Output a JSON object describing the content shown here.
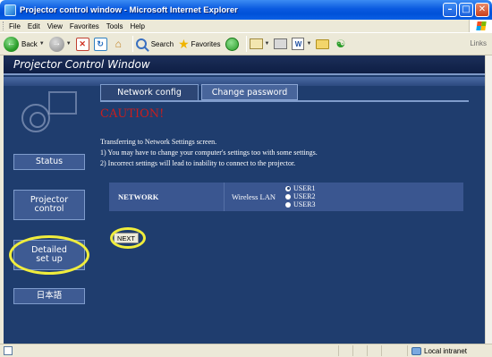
{
  "window": {
    "title": "Projector control window - Microsoft Internet Explorer",
    "minimize": "–",
    "maximize": "□",
    "close": "✕"
  },
  "menu": {
    "items": [
      "File",
      "Edit",
      "View",
      "Favorites",
      "Tools",
      "Help"
    ]
  },
  "toolbar": {
    "back_label": "Back",
    "search_label": "Search",
    "favorites_label": "Favorites",
    "links_label": "Links",
    "icons": [
      "back-icon",
      "forward-icon",
      "stop-icon",
      "refresh-icon",
      "home-icon",
      "search-icon",
      "favorites-icon",
      "history-icon",
      "mail-icon",
      "print-icon",
      "edit-icon",
      "folder-icon",
      "messenger-icon"
    ]
  },
  "page": {
    "header_title": "Projector Control Window",
    "sidebar": {
      "status": "Status",
      "projector_control": "Projector\ncontrol",
      "detailed_setup": "Detailed\nset up",
      "language": "日本語"
    },
    "tabs": {
      "network_config": "Network config",
      "change_password": "Change password"
    },
    "caution": "CAUTION!",
    "messages": [
      "Transferring to Network Settings screen.",
      "1)   You may have to change your computer's settings too with some settings.",
      "2)   Incorrect settings will lead to inability to connect to the projector."
    ],
    "network": {
      "label": "NETWORK",
      "wireless_label": "Wireless LAN",
      "options": [
        "USER1",
        "USER2",
        "USER3"
      ],
      "selected": "USER1"
    },
    "next_button": "NEXT"
  },
  "statusbar": {
    "zone": "Local intranet"
  },
  "colors": {
    "page_background": "#1f3d6e",
    "caution_red": "#c81e1e",
    "highlight_yellow": "#f0ed3c"
  }
}
